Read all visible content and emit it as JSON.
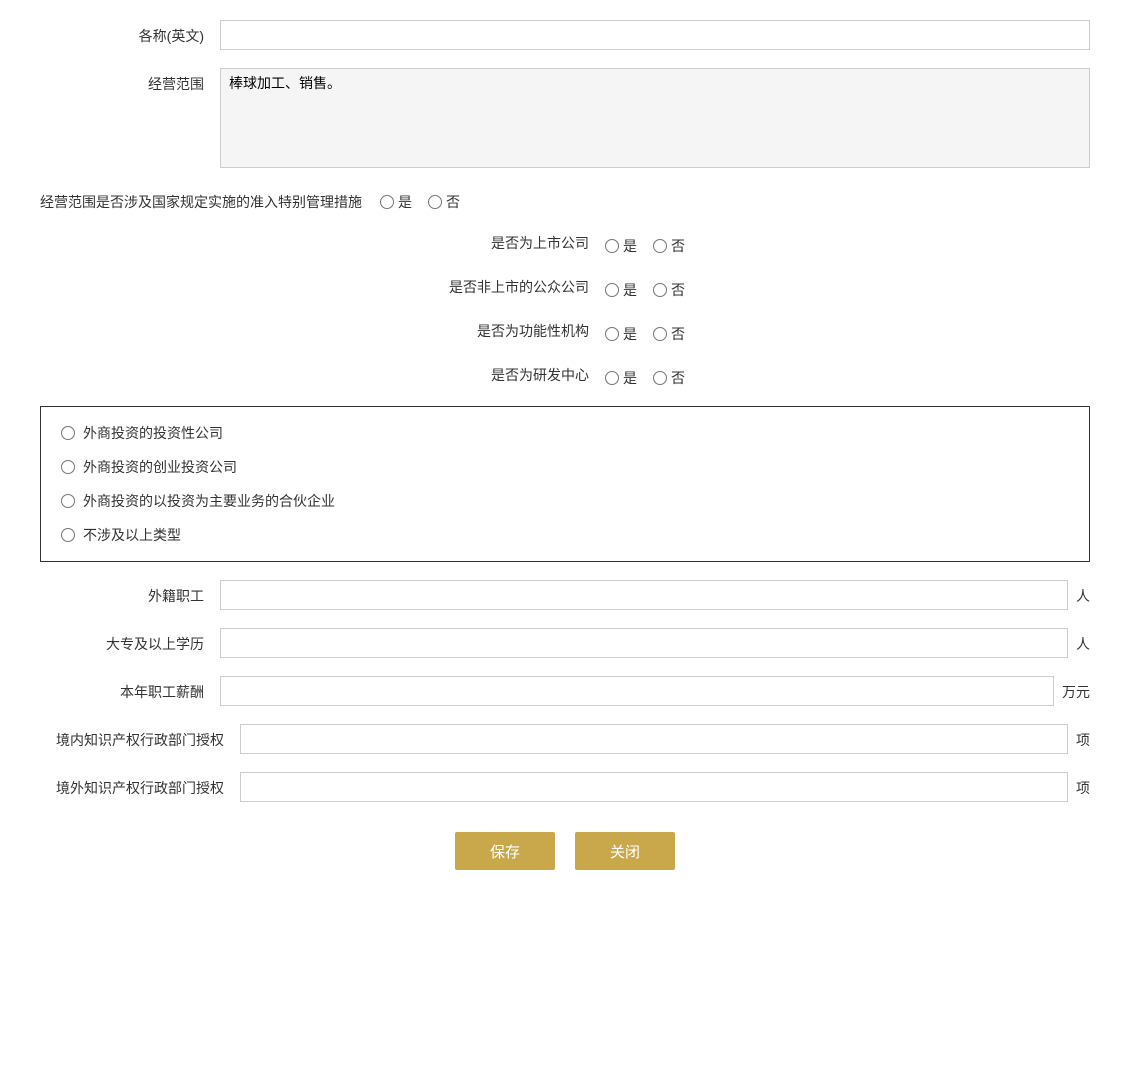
{
  "form": {
    "name_en_label": "各称(英文)",
    "name_en_placeholder": "",
    "business_scope_label": "经营范围",
    "business_scope_value": "棒球加工、销售。",
    "special_mgmt_label": "经营范围是否涉及国家规定实施的准入特别管理措施",
    "special_mgmt_yes": "是",
    "special_mgmt_no": "否",
    "listed_company_label": "是否为上市公司",
    "listed_yes": "是",
    "listed_no": "否",
    "public_company_label": "是否非上市的公众公司",
    "public_yes": "是",
    "public_no": "否",
    "functional_org_label": "是否为功能性机构",
    "functional_yes": "是",
    "functional_no": "否",
    "rd_center_label": "是否为研发中心",
    "rd_yes": "是",
    "rd_no": "否",
    "investment_company_option": "外商投资的投资性公司",
    "venture_company_option": "外商投资的创业投资公司",
    "partnership_option": "外商投资的以投资为主要业务的合伙企业",
    "not_involved_option": "不涉及以上类型",
    "foreign_staff_label": "外籍职工",
    "foreign_staff_suffix": "人",
    "college_edu_label": "大专及以上学历",
    "college_edu_suffix": "人",
    "annual_salary_label": "本年职工薪酬",
    "annual_salary_suffix": "万元",
    "domestic_ip_label": "境内知识产权行政部门授权",
    "domestic_ip_suffix": "项",
    "foreign_ip_label": "境外知识产权行政部门授权",
    "foreign_ip_suffix": "项",
    "save_btn": "保存",
    "close_btn": "关闭"
  }
}
